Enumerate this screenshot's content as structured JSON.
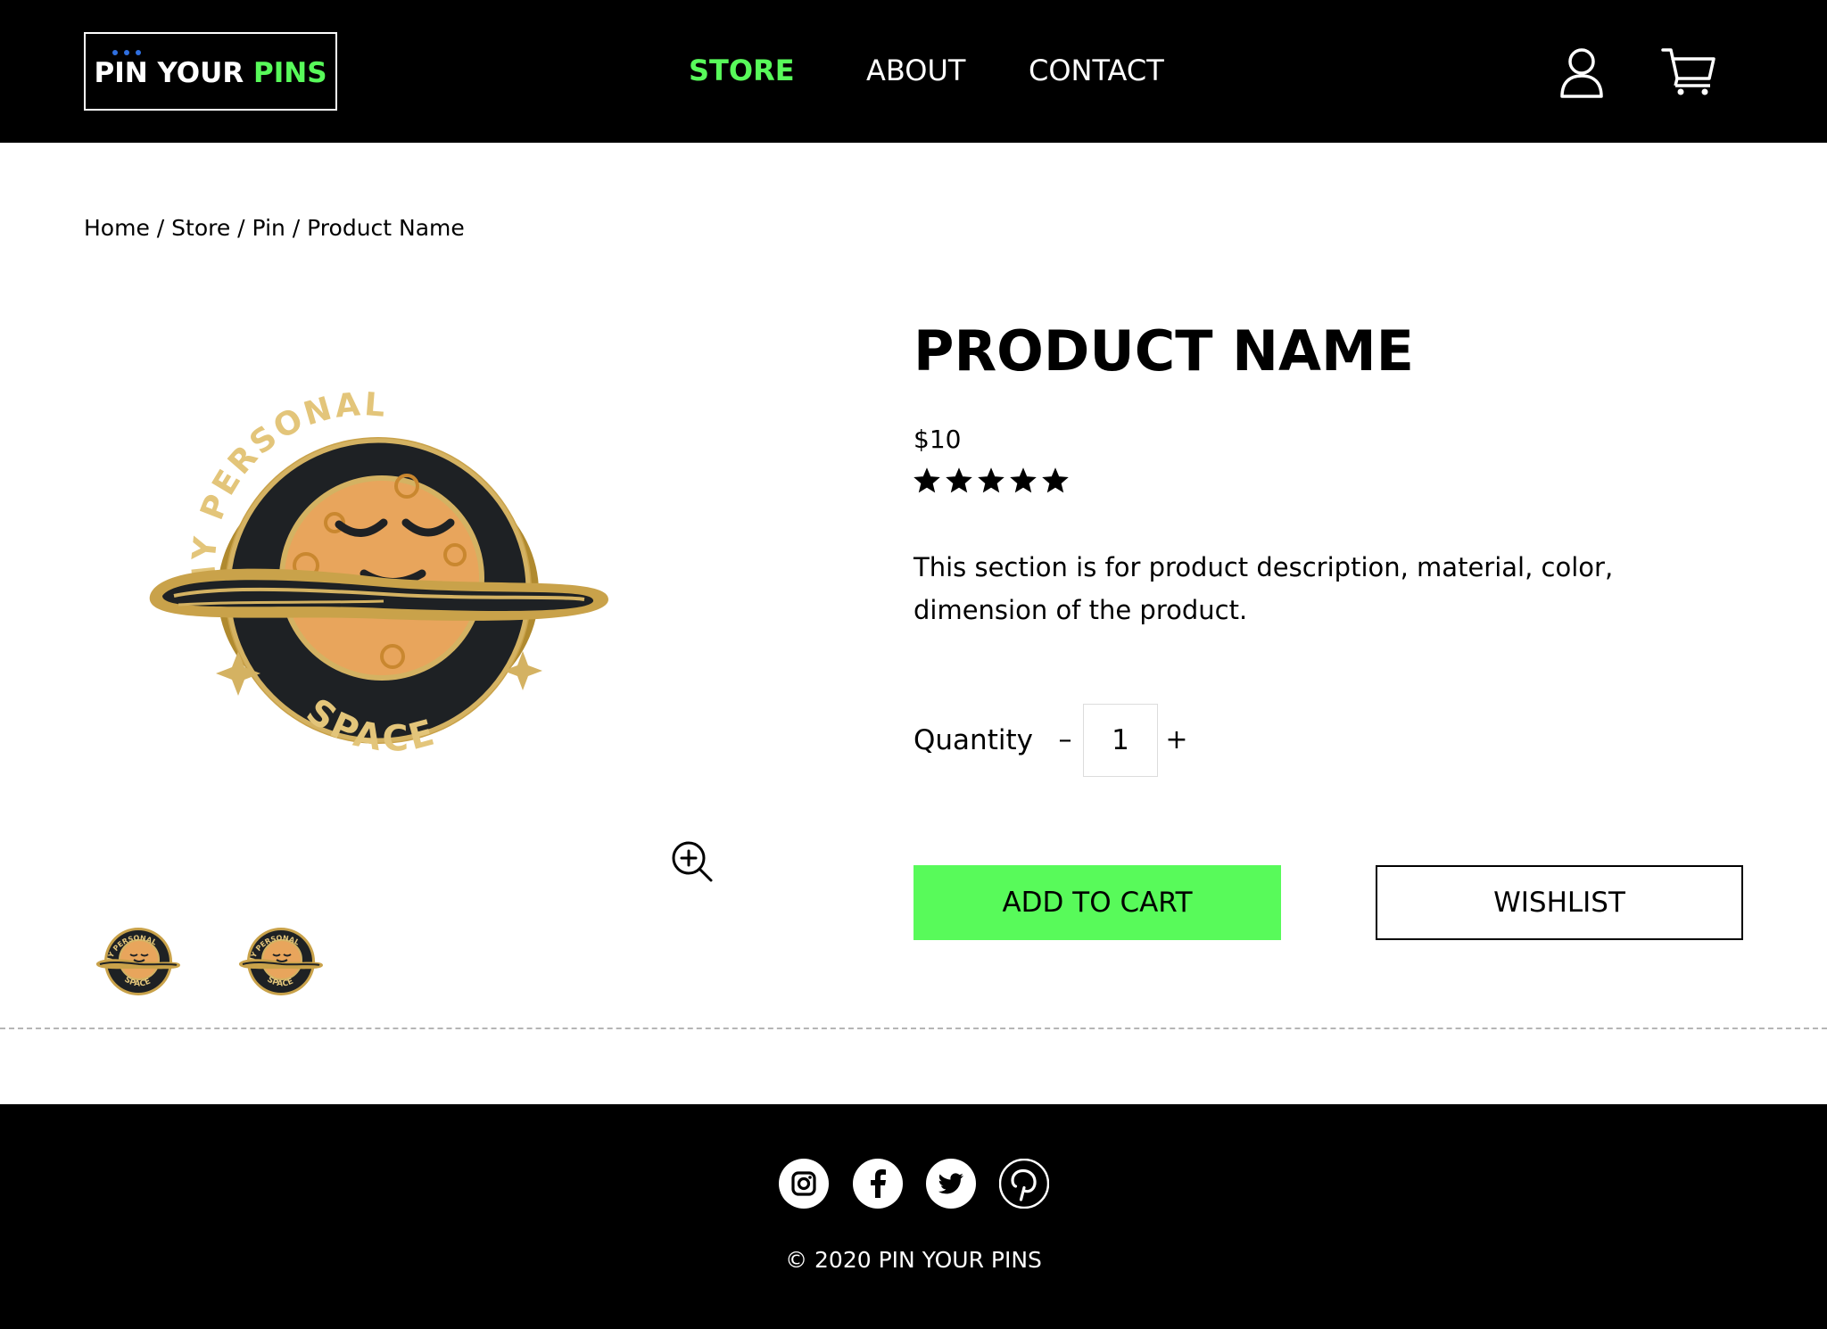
{
  "colors": {
    "accent_green": "#58fa5a",
    "header_bg": "#000000",
    "logo_dots": "#2f6fe0"
  },
  "header": {
    "logo_white": "PIN YOUR ",
    "logo_green": "PINS",
    "nav": [
      "STORE",
      "ABOUT",
      "CONTACT"
    ],
    "active_nav": "STORE",
    "icons": [
      "user-icon",
      "cart-icon"
    ]
  },
  "breadcrumb": "Home / Store / Pin / Product Name",
  "product": {
    "title": "PRODUCT NAME",
    "price": "$10",
    "rating": 5,
    "rating_max": 5,
    "description": "This section is for product description, material, color, dimension of the product.",
    "quantity_label": "Quantity",
    "quantity_minus": "–",
    "quantity_value": "1",
    "quantity_plus": "+",
    "add_to_cart": "ADD TO CART",
    "wishlist": "WISHLIST",
    "image": {
      "top_text": "MY PERSONAL",
      "bottom_text": "SPACE"
    }
  },
  "footer": {
    "social_icons": [
      "instagram-icon",
      "facebook-icon",
      "twitter-icon",
      "pinterest-icon"
    ],
    "copyright": "© 2020 PIN YOUR PINS"
  }
}
